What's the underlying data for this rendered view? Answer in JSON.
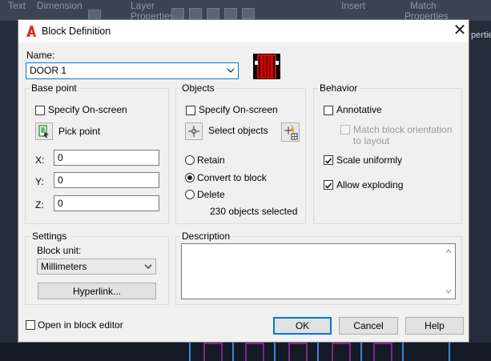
{
  "background": {
    "ribbon_labels": [
      "Text",
      "Dimension",
      "Layer",
      "Properties",
      "Insert",
      "Match",
      "Properties"
    ],
    "side_label": "perties"
  },
  "dialog": {
    "title": "Block Definition",
    "name_label": "Name:",
    "name_value": "DOOR 1",
    "base_point": {
      "title": "Base point",
      "specify_label": "Specify On-screen",
      "specify_checked": false,
      "pick_label": "Pick point",
      "x_label": "X:",
      "x_value": "0",
      "y_label": "Y:",
      "y_value": "0",
      "z_label": "Z:",
      "z_value": "0"
    },
    "objects": {
      "title": "Objects",
      "specify_label": "Specify On-screen",
      "specify_checked": false,
      "select_label": "Select objects",
      "retain_label": "Retain",
      "convert_label": "Convert to block",
      "delete_label": "Delete",
      "selected_option": "Convert to block",
      "status": "230 objects selected"
    },
    "behavior": {
      "title": "Behavior",
      "annotative_label": "Annotative",
      "annotative_checked": false,
      "match_label_1": "Match block orientation",
      "match_label_2": "to layout",
      "match_checked": false,
      "scale_label": "Scale uniformly",
      "scale_checked": true,
      "explode_label": "Allow exploding",
      "explode_checked": true
    },
    "settings": {
      "title": "Settings",
      "unit_label": "Block unit:",
      "unit_value": "Millimeters",
      "hyperlink_label": "Hyperlink..."
    },
    "description": {
      "title": "Description",
      "value": ""
    },
    "open_editor_label": "Open in block editor",
    "open_editor_checked": false,
    "ok_label": "OK",
    "cancel_label": "Cancel",
    "help_label": "Help"
  },
  "colors": {
    "accent": "#0078d7",
    "app_icon": "#d32f2f",
    "preview_red": "#e00000"
  }
}
